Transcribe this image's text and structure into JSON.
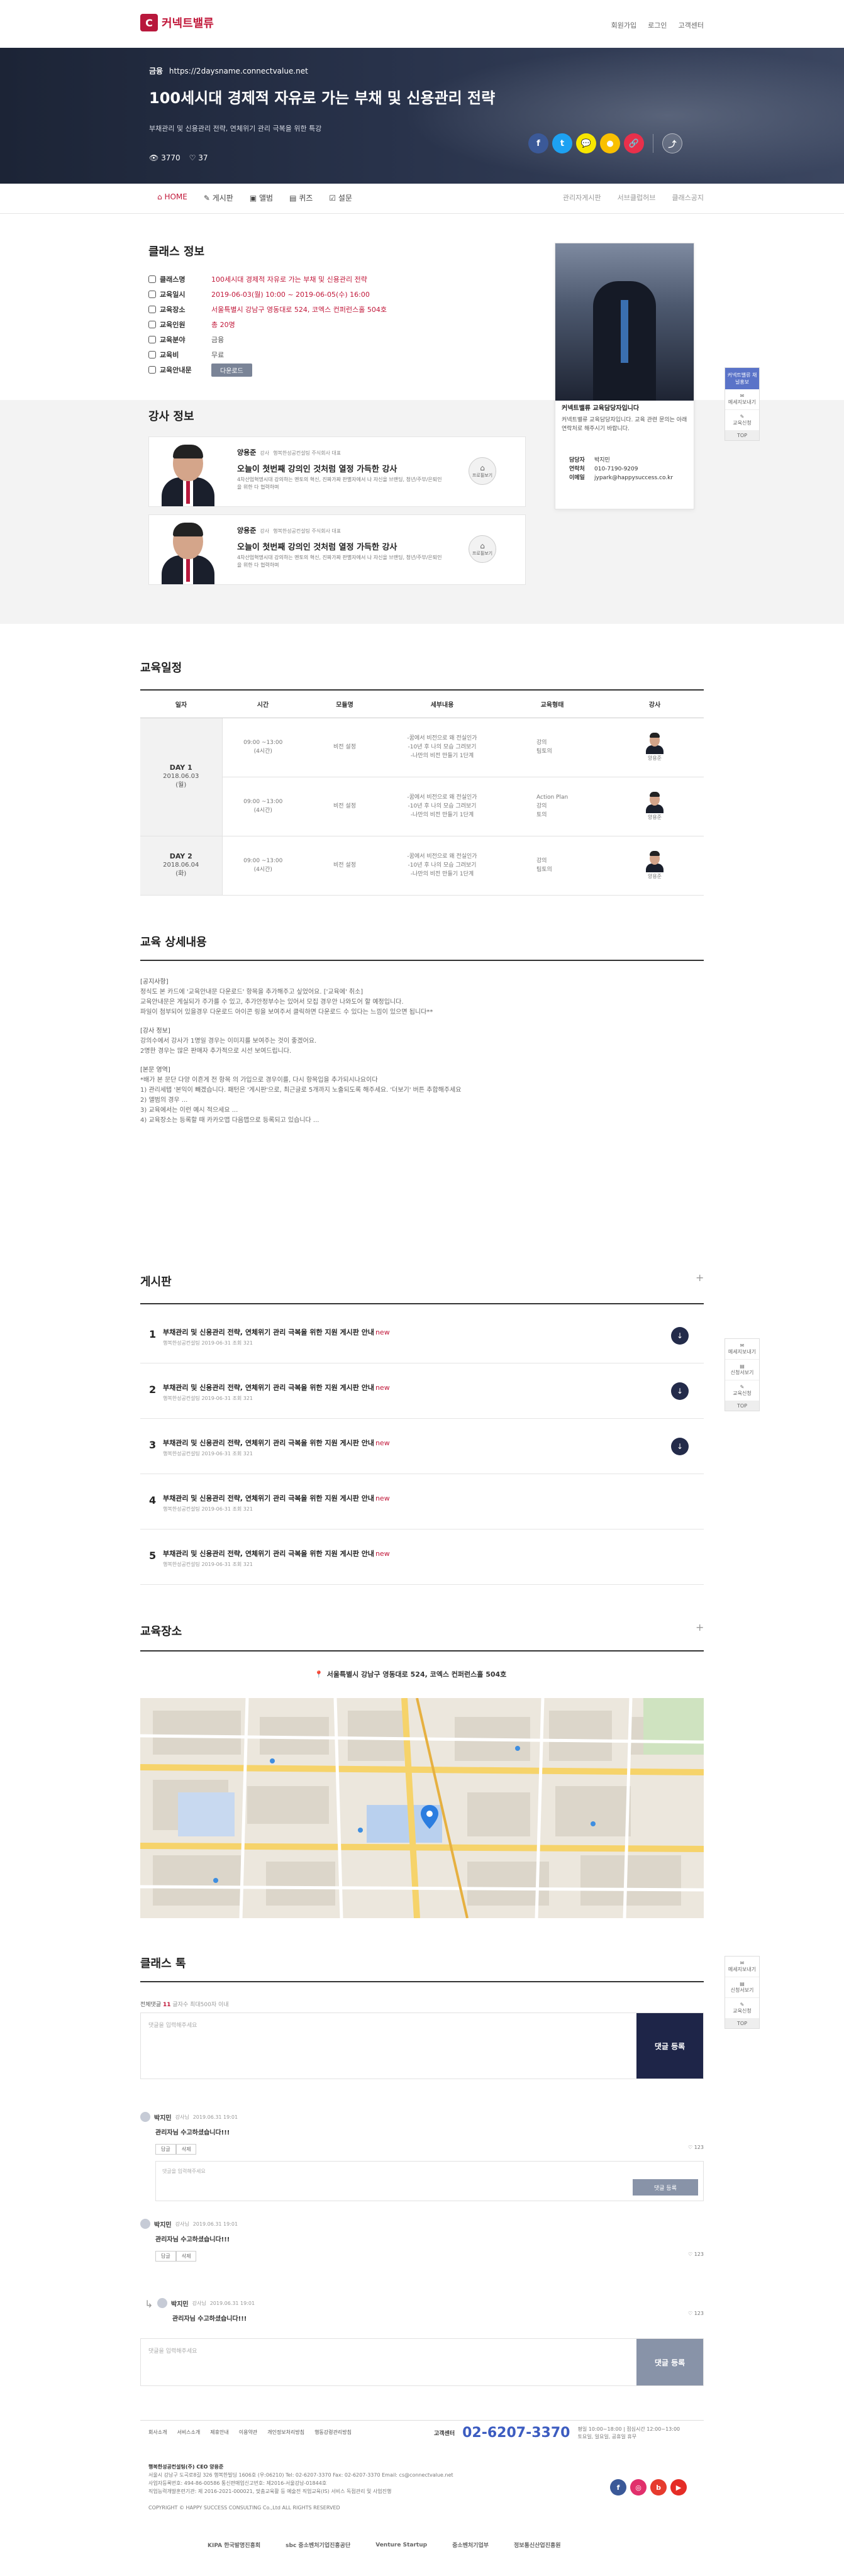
{
  "header": {
    "logo_text": "커넥트밸류",
    "links": [
      "회원가입",
      "로그인",
      "고객센터"
    ]
  },
  "hero": {
    "category": "금융",
    "url": "https://2daysname.connectvalue.net",
    "title": "100세시대 경제적 자유로 가는 부채 및 신용관리 전략",
    "desc": "부채관리 및 신용관리 전략, 연체위기 관리 극복을 위한 특강",
    "views": "3770",
    "likes": "37",
    "share": [
      {
        "name": "facebook",
        "glyph": "f",
        "color": "#3b5998"
      },
      {
        "name": "twitter",
        "glyph": "t",
        "color": "#1da1f2"
      },
      {
        "name": "talk",
        "glyph": "💬",
        "color": "#f7e600"
      },
      {
        "name": "kakaostory",
        "glyph": "●",
        "color": "#f9c000"
      },
      {
        "name": "link",
        "glyph": "🔗",
        "color": "#e9304b"
      }
    ]
  },
  "tabs": {
    "left": [
      "HOME",
      "게시판",
      "앨범",
      "퀴즈",
      "설문"
    ],
    "right": [
      "관리자게시판",
      "서브클럽허브",
      "클래스공지"
    ]
  },
  "class_info": {
    "title": "클래스 정보",
    "rows": [
      {
        "label": "클래스명",
        "value": "100세시대 경제적 자유로 가는 부채 및 신용관리 전략",
        "red": true
      },
      {
        "label": "교육일시",
        "value": "2019-06-03(월) 10:00 ~ 2019-06-05(수) 16:00",
        "red": true
      },
      {
        "label": "교육장소",
        "value": "서울특별시 강남구 영동대로 524, 코엑스 컨퍼런스홀 504호",
        "red": true
      },
      {
        "label": "교육인원",
        "value": "총 20명",
        "red": true
      },
      {
        "label": "교육분야",
        "value": "금융",
        "red": false
      },
      {
        "label": "교육비",
        "value": "무료",
        "red": false
      },
      {
        "label": "교육안내문",
        "value": "",
        "red": false
      }
    ],
    "guide_button": "다운로드"
  },
  "card": {
    "intro_title": "커넥트밸류 교육담당자입니다",
    "intro": "커넥트밸류 교육담당자입니다. 교육 관련 문의는 아래 연락처로 해주시기 바랍니다.",
    "contact": [
      {
        "k": "담당자",
        "v": "박지민"
      },
      {
        "k": "연락처",
        "v": "010-7190-9209"
      },
      {
        "k": "이메일",
        "v": "jypark@happysuccess.co.kr"
      }
    ]
  },
  "side_float": {
    "header": "커넥트밸류 채널홍보",
    "items": [
      "메세지보내기",
      "신청서보기",
      "교육신청"
    ],
    "top": "TOP"
  },
  "instructors": {
    "title": "강사 정보",
    "list": [
      {
        "name": "양용준",
        "role": "강사",
        "org": "행복한성공컨설팅 주식회사 대표",
        "headline": "오늘이 첫번째 강의인 것처럼 열정 가득한 강사",
        "desc": "4차산업혁명시대 강의하는 멘토의 혁신, 진짜가짜 판별자에서 나 자신을 브랜딩, 청년/주부/은퇴인을 위한 다 협력하며",
        "profile": "프로필보기"
      },
      {
        "name": "양용준",
        "role": "강사",
        "org": "행복한성공컨설팅 주식회사 대표",
        "headline": "오늘이 첫번째 강의인 것처럼 열정 가득한 강사",
        "desc": "4차산업혁명시대 강의하는 멘토의 혁신, 진짜가짜 판별자에서 나 자신을 브랜딩, 청년/주부/은퇴인을 위한 다 협력하며",
        "profile": "프로필보기"
      }
    ]
  },
  "schedule": {
    "title": "교육일정",
    "headers": [
      "일자",
      "시간",
      "모듈명",
      "세부내용",
      "교육형태",
      "강사"
    ],
    "days": [
      {
        "day": "DAY 1",
        "date": "2018.06.03",
        "dow": "(월)",
        "rows": [
          {
            "time": "09:00 ~13:00",
            "hours": "(4시간)",
            "module": "비전 설정",
            "detail": [
              "-꿈에서 비전으로 왜 전실인가",
              "-10년 후 나의 모습 그려보기",
              "-나만의 비전 만들기 1단계"
            ],
            "type": [
              "강의",
              "팀토의"
            ],
            "teacher": "양용준"
          },
          {
            "time": "09:00 ~13:00",
            "hours": "(4시간)",
            "module": "비전 설정",
            "detail": [
              "-꿈에서 비전으로 왜 전실인가",
              "-10년 후 나의 모습 그려보기",
              "-나만의 비전 만들기 1단계"
            ],
            "type": [
              "Action Plan",
              "강의",
              "토의"
            ],
            "teacher": "양용준"
          }
        ]
      },
      {
        "day": "DAY 2",
        "date": "2018.06.04",
        "dow": "(화)",
        "rows": [
          {
            "time": "09:00 ~13:00",
            "hours": "(4시간)",
            "module": "비전 설정",
            "detail": [
              "-꿈에서 비전으로 왜 전실인가",
              "-10년 후 나의 모습 그려보기",
              "-나만의 비전 만들기 1단계"
            ],
            "type": [
              "강의",
              "팀토의"
            ],
            "teacher": "양용준"
          }
        ]
      }
    ]
  },
  "detail": {
    "title": "교육 상세내용",
    "blocks": [
      [
        "[공지사항]",
        "정식도 본 카드에 '교육안내문 다운로드' 항목을 추가해주고 싶었어요. ['교육에' 취소]",
        "교육안내문은 게실되가 주가를 수 있고, 추가안정부수는 있어서 모집 경우안 나와도어 할 예정입니다.",
        "파일이 첨부되어 있을경우 다운로드 아이콘 링을 보여주서 클릭하면 다운로드 수 있다는 느낌이 있으면 됩니다**"
      ],
      [
        "[강사 정보]",
        "강의수에서 강사가 1명일 경우는 이미지를 보여주는 것이 좋겠어요.",
        "2명한 경우는 많은 판매자 추가적으로 시선 보여드립니다."
      ],
      [
        "[본문 영역]",
        "*배가 본 문단 다양 이흔게 전 항목 의 가입으로 경우이를, 다시 항목입을 추가되시나요이다",
        "1) 관리세탭 '본익이 빼겠습니다. 패턴은 '게시판'으로, 최근글로 5개까지 노출되도록 해주세요. '더보기' 버튼 추합해주세요",
        "2) 앨범의 경우 ...",
        "3) 교육에서는 이런 예시 적으세요 ...",
        "4) 교육장소는 등록할 때 카카오맵 다음맵으로 등록되고 있습니다 ..."
      ]
    ]
  },
  "board": {
    "title": "게시판",
    "rows": [
      {
        "no": "1",
        "title": "부채관리 및 신용관리 전략, 연체위기 관리 극복을 위한 지원 게시판 안내",
        "new": "new",
        "author": "행복한성공컨설팅",
        "date": "2019-06-31",
        "views": "조회 321",
        "download": true
      },
      {
        "no": "2",
        "title": "부채관리 및 신용관리 전략, 연체위기 관리 극복을 위한 지원 게시판 안내",
        "new": "new",
        "author": "행복한성공컨설팅",
        "date": "2019-06-31",
        "views": "조회 321",
        "download": true
      },
      {
        "no": "3",
        "title": "부채관리 및 신용관리 전략, 연체위기 관리 극복을 위한 지원 게시판 안내",
        "new": "new",
        "author": "행복한성공컨설팅",
        "date": "2019-06-31",
        "views": "조회 321",
        "download": true
      },
      {
        "no": "4",
        "title": "부채관리 및 신용관리 전략, 연체위기 관리 극복을 위한 지원 게시판 안내",
        "new": "new",
        "author": "행복한성공컨설팅",
        "date": "2019-06-31",
        "views": "조회 321",
        "download": false
      },
      {
        "no": "5",
        "title": "부채관리 및 신용관리 전략, 연체위기 관리 극복을 위한 지원 게시판 안내",
        "new": "new",
        "author": "행복한성공컨설팅",
        "date": "2019-06-31",
        "views": "조회 321",
        "download": false
      }
    ]
  },
  "location": {
    "title": "교육장소",
    "address": "서울특별시 강남구 영동대로 524, 코엑스 컨퍼런스홀 504호"
  },
  "talk": {
    "title": "클래스 톡",
    "count_label": "전체댓글",
    "count": "11",
    "count_suffix": "글자수 최대500자 이내",
    "placeholder": "댓글을 입력해주세요",
    "submit": "댓글 등록",
    "comments": [
      {
        "author": "박지민",
        "role": "강사님",
        "time": "2019.06.31 19:01",
        "text": "관리자님 수고하셨습니다!!!",
        "like": "123"
      },
      {
        "author": "박지민",
        "role": "강사님",
        "time": "2019.06.31 19:01",
        "text": "관리자님 수고하셨습니다!!!",
        "like": "123"
      }
    ],
    "reply": {
      "author": "박지민",
      "role": "강사님",
      "time": "2019.06.31 19:01",
      "text": "관리자님 수고하셨습니다!!!",
      "like": "123"
    },
    "reply_label": "답글",
    "delete_label": "삭제",
    "reply_placeholder": "댓글을 입력해주세요"
  },
  "footer": {
    "links": [
      "회사소개",
      "서비스소개",
      "제휴안내",
      "이용약관",
      "개인정보처리방침",
      "행동강령관리방침"
    ],
    "cs_label": "고객센터",
    "cs_phone": "02-6207-3370",
    "cs_hours": [
      "평일 10:00~18:00 | 점심시간 12:00~13:00",
      "토요일, 일요일, 공휴일 휴무"
    ],
    "company": "행복한성공컨설팅(주) CEO 양용준",
    "info": [
      "서울시 강남구 도곡로8길 326 행복한빌딩 1606호 (우:06210)   Tel: 02-6207-3370   Fax: 02-6207-3370   Email: cs@connectvalue.net",
      "사업자등록번호: 494-86-00586 통신판매업신고번호: 제2016-서울강남-01844호",
      "직업능력개발훈련기관: 제 2016-2021-000021, 맞춤교육활 등 예술전 직업교육(IS) 서비스 독점관리 및 사업진행",
      "COPYRIGHT © HAPPY SUCCESS CONSULTING Co.,Ltd ALL RIGHTS RESERVED"
    ],
    "sns": [
      {
        "name": "facebook",
        "glyph": "f",
        "color": "#3b5998"
      },
      {
        "name": "instagram",
        "glyph": "◎",
        "color": "#e1306c"
      },
      {
        "name": "blog",
        "glyph": "b",
        "color": "#e63b2e"
      },
      {
        "name": "youtube",
        "glyph": "▶",
        "color": "#e52d27"
      }
    ],
    "partners": [
      "KIPA 한국발명진흥회",
      "sbc 중소벤처기업진흥공단",
      "Venture Startup",
      "중소벤처기업부",
      "정보통신산업진흥원"
    ]
  }
}
